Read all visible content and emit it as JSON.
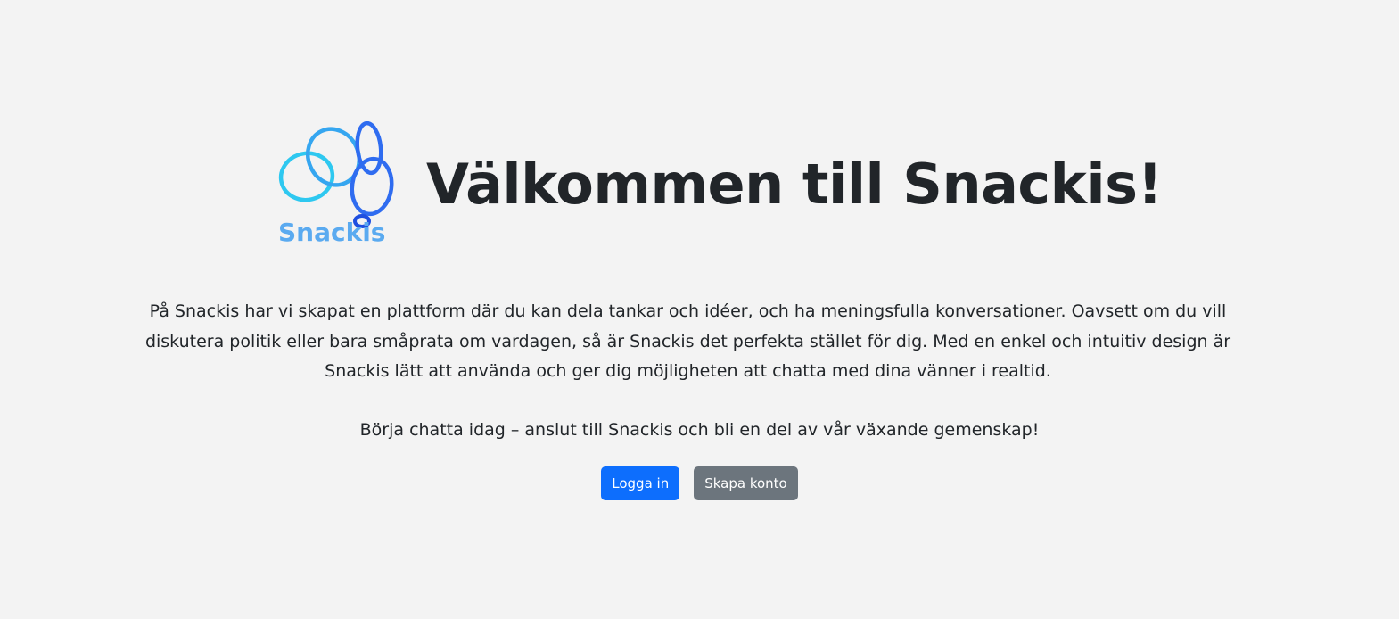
{
  "logo": {
    "wordmark": "Snackis",
    "colors": {
      "cyan": "#2ec8f0",
      "sky": "#35a6f0",
      "blue": "#2f6cf0",
      "wordmark": "#5aaaf0"
    }
  },
  "hero": {
    "title": "Välkommen till Snackis!",
    "intro": "På Snackis har vi skapat en plattform där du kan dela tankar och idéer, och ha meningsfulla konversationer. Oavsett om du vill diskutera politik eller bara småprata om vardagen, så är Snackis det perfekta stället för dig. Med en enkel och intuitiv design är Snackis lätt att använda och ger dig möjligheten att chatta med dina vänner i realtid.",
    "cta": "Börja chatta idag – anslut till Snackis och bli en del av vår växande gemenskap!"
  },
  "buttons": {
    "login_label": "Logga in",
    "register_label": "Skapa konto"
  },
  "colors": {
    "background": "#f3f3f3",
    "text": "#212529",
    "primary": "#0d6efd",
    "secondary": "#6c757d"
  }
}
